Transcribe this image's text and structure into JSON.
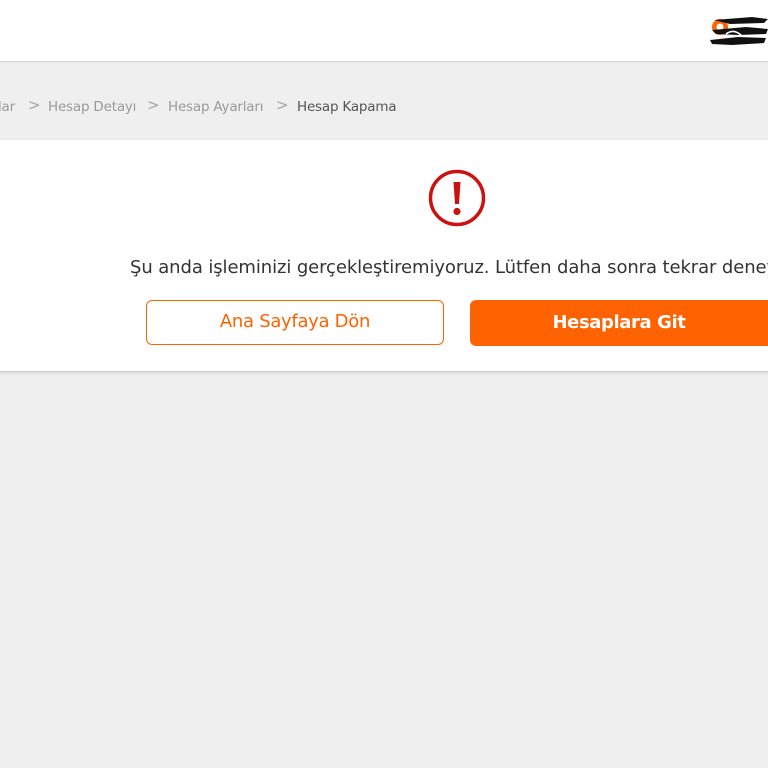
{
  "header": {
    "logo_icon": "ing-lion-logo-icon"
  },
  "breadcrumb": {
    "items": [
      {
        "label": "lar"
      },
      {
        "label": "Hesap Detayı"
      },
      {
        "label": "Hesap Ayarları"
      },
      {
        "label": "Hesap Kapama"
      }
    ],
    "separator": ">"
  },
  "error_card": {
    "icon": "exclamation-circle-icon",
    "message": "Şu anda işleminizi gerçekleştiremiyoruz. Lütfen daha sonra tekrar deneyi",
    "secondary_button": "Ana Sayfaya Dön",
    "primary_button": "Hesaplara Git"
  },
  "colors": {
    "accent": "#ff6200",
    "error": "#cc1111",
    "background": "#efefef"
  }
}
